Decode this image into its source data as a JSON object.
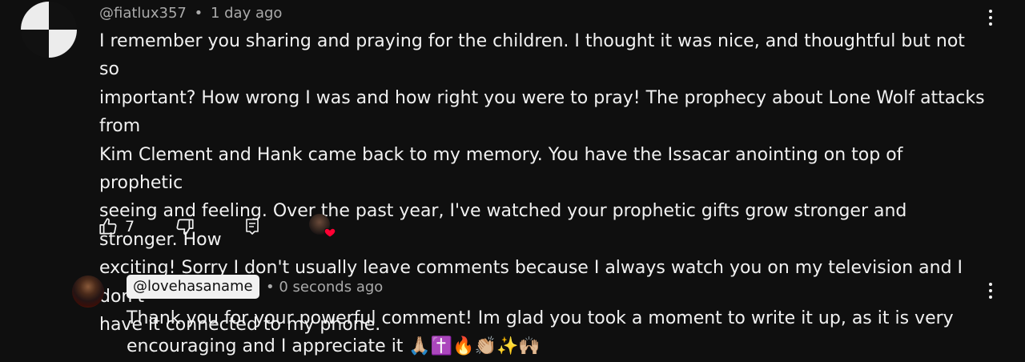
{
  "comment": {
    "author": "@fiatlux357",
    "separator": "•",
    "time": "1 day ago",
    "lines": [
      "I remember you sharing and praying for the children. I thought it was nice, and thoughtful but not so",
      "important? How wrong I was and how right you were to pray! The prophecy about Lone Wolf attacks from",
      "Kim Clement and Hank came back to my memory. You have the Issacar  anointing on top of prophetic",
      "seeing and feeling. Over the past year, I've watched your prophetic gifts grow stronger and stronger. How",
      "exciting! Sorry I don't usually leave comments because I always watch you on my television and I don't",
      "have it connected to my phone."
    ],
    "like_count": "7",
    "icons": {
      "avatar": "checkered-circle-avatar",
      "like": "thumbs-up-icon",
      "dislike": "thumbs-down-icon",
      "reply": "reply-comment-icon",
      "creator_heart": "creator-heart-icon",
      "menu": "more-vertical-icon"
    }
  },
  "reply": {
    "author": "@lovehasaname",
    "separator": "•",
    "time": "0 seconds ago",
    "lines": [
      "Thank you for your powerful comment! Im glad you took a moment to write it up, as it is very",
      "encouraging and I appreciate it 🙏🏼✝️🔥👏🏼✨🙌🏼"
    ],
    "icons": {
      "avatar": "user-photo-avatar",
      "menu": "more-vertical-icon"
    }
  },
  "colors": {
    "background": "#0f0f0f",
    "text": "#f1f1f1",
    "secondary_text": "#aaaaaa",
    "heart": "#ff0033"
  }
}
